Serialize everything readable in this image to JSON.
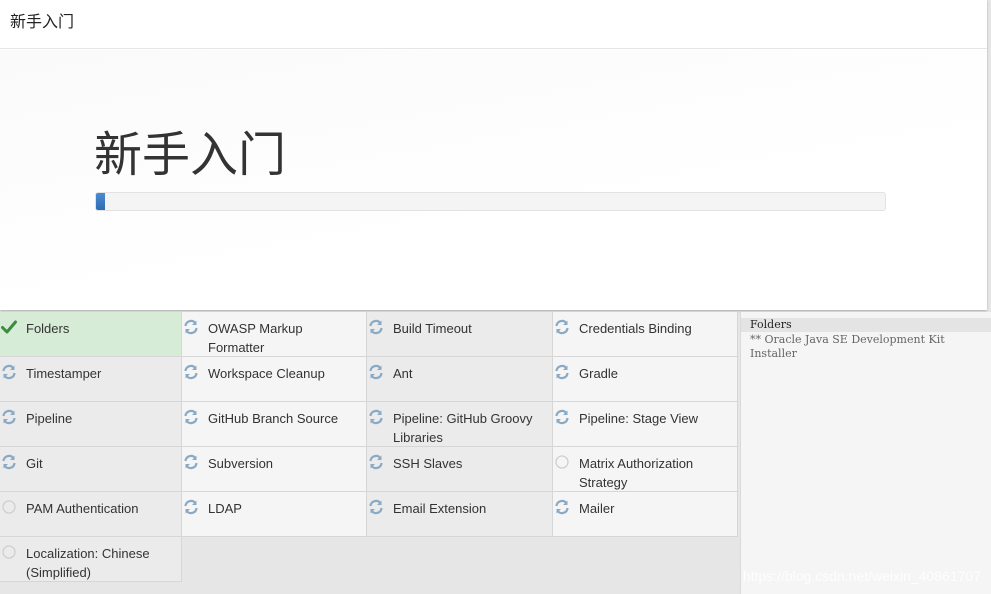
{
  "window": {
    "title": "新手入门"
  },
  "hero": {
    "heading": "新手入门",
    "progress_fraction": 0.012
  },
  "colors": {
    "success_bg": "#d6ecd6",
    "progress": "#3a7cc4",
    "check": "#4a9a4a"
  },
  "plugins": [
    {
      "label": "Folders",
      "status": "done",
      "icon": "check-icon"
    },
    {
      "label": "OWASP Markup Formatter",
      "status": "installing",
      "icon": "refresh-icon"
    },
    {
      "label": "Build Timeout",
      "status": "installing",
      "icon": "refresh-icon"
    },
    {
      "label": "Credentials Binding",
      "status": "installing",
      "icon": "refresh-icon"
    },
    {
      "label": "Timestamper",
      "status": "installing",
      "icon": "refresh-icon"
    },
    {
      "label": "Workspace Cleanup",
      "status": "installing",
      "icon": "refresh-icon"
    },
    {
      "label": "Ant",
      "status": "installing",
      "icon": "refresh-icon"
    },
    {
      "label": "Gradle",
      "status": "installing",
      "icon": "refresh-icon"
    },
    {
      "label": "Pipeline",
      "status": "installing",
      "icon": "refresh-icon"
    },
    {
      "label": "GitHub Branch Source",
      "status": "installing",
      "icon": "refresh-icon"
    },
    {
      "label": "Pipeline: GitHub Groovy Libraries",
      "status": "installing",
      "icon": "refresh-icon"
    },
    {
      "label": "Pipeline: Stage View",
      "status": "installing",
      "icon": "refresh-icon"
    },
    {
      "label": "Git",
      "status": "installing",
      "icon": "refresh-icon"
    },
    {
      "label": "Subversion",
      "status": "installing",
      "icon": "refresh-icon"
    },
    {
      "label": "SSH Slaves",
      "status": "installing",
      "icon": "refresh-icon"
    },
    {
      "label": "Matrix Authorization Strategy",
      "status": "pending",
      "icon": "circle-icon"
    },
    {
      "label": "PAM Authentication",
      "status": "pending",
      "icon": "circle-icon"
    },
    {
      "label": "LDAP",
      "status": "installing",
      "icon": "refresh-icon"
    },
    {
      "label": "Email Extension",
      "status": "installing",
      "icon": "refresh-icon"
    },
    {
      "label": "Mailer",
      "status": "installing",
      "icon": "refresh-icon"
    },
    {
      "label": "Localization: Chinese (Simplified)",
      "status": "pending",
      "icon": "circle-icon"
    }
  ],
  "log": {
    "header": "Folders",
    "lines": [
      "** Oracle Java SE Development Kit Installer"
    ]
  },
  "watermark": "https://blog.csdn.net/weixin_40861707"
}
